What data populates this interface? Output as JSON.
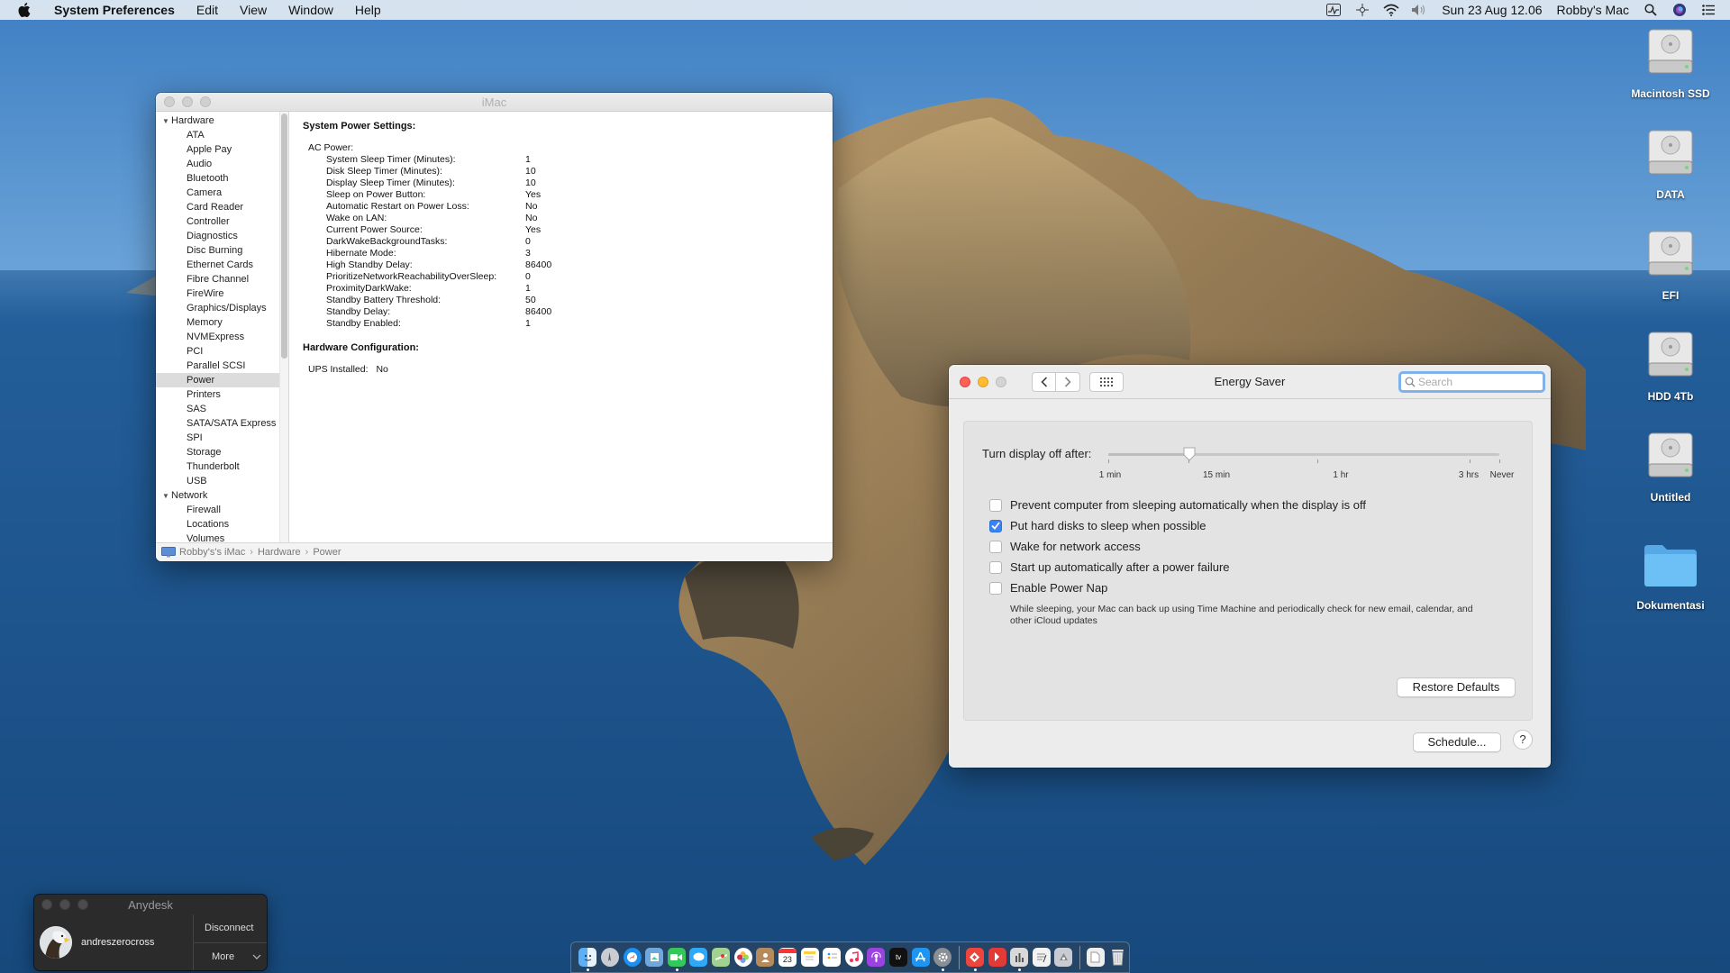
{
  "menubar": {
    "app_name": "System Preferences",
    "menus": [
      "Edit",
      "View",
      "Window",
      "Help"
    ],
    "clock": "Sun 23 Aug  12.06",
    "user": "Robby's Mac"
  },
  "desktop": {
    "icons": [
      {
        "label": "Macintosh SSD",
        "type": "disk"
      },
      {
        "label": "DATA",
        "type": "disk"
      },
      {
        "label": "EFI",
        "type": "disk"
      },
      {
        "label": "HDD 4Tb",
        "type": "disk"
      },
      {
        "label": "Untitled",
        "type": "disk"
      },
      {
        "label": "Dokumentasi",
        "type": "folder"
      }
    ]
  },
  "sysinfo": {
    "title": "iMac",
    "sidebar": {
      "groups": [
        {
          "label": "Hardware",
          "items": [
            "ATA",
            "Apple Pay",
            "Audio",
            "Bluetooth",
            "Camera",
            "Card Reader",
            "Controller",
            "Diagnostics",
            "Disc Burning",
            "Ethernet Cards",
            "Fibre Channel",
            "FireWire",
            "Graphics/Displays",
            "Memory",
            "NVMExpress",
            "PCI",
            "Parallel SCSI",
            "Power",
            "Printers",
            "SAS",
            "SATA/SATA Express",
            "SPI",
            "Storage",
            "Thunderbolt",
            "USB"
          ]
        },
        {
          "label": "Network",
          "items": [
            "Firewall",
            "Locations",
            "Volumes"
          ]
        }
      ],
      "selected": "Power"
    },
    "content": {
      "heading1": "System Power Settings:",
      "ac_power_label": "AC Power:",
      "settings": [
        {
          "k": "System Sleep Timer (Minutes):",
          "v": "1"
        },
        {
          "k": "Disk Sleep Timer (Minutes):",
          "v": "10"
        },
        {
          "k": "Display Sleep Timer (Minutes):",
          "v": "10"
        },
        {
          "k": "Sleep on Power Button:",
          "v": "Yes"
        },
        {
          "k": "Automatic Restart on Power Loss:",
          "v": "No"
        },
        {
          "k": "Wake on LAN:",
          "v": "No"
        },
        {
          "k": "Current Power Source:",
          "v": "Yes"
        },
        {
          "k": "DarkWakeBackgroundTasks:",
          "v": "0"
        },
        {
          "k": "Hibernate Mode:",
          "v": "3"
        },
        {
          "k": "High Standby Delay:",
          "v": "86400"
        },
        {
          "k": "PrioritizeNetworkReachabilityOverSleep:",
          "v": "0"
        },
        {
          "k": "ProximityDarkWake:",
          "v": "1"
        },
        {
          "k": "Standby Battery Threshold:",
          "v": "50"
        },
        {
          "k": "Standby Delay:",
          "v": "86400"
        },
        {
          "k": "Standby Enabled:",
          "v": "1"
        }
      ],
      "heading2": "Hardware Configuration:",
      "ups_label": "UPS Installed:",
      "ups_value": "No"
    },
    "pathbar": [
      "Robby's's iMac",
      "Hardware",
      "Power"
    ]
  },
  "energy": {
    "title": "Energy Saver",
    "search_placeholder": "Search",
    "slider_label": "Turn display off after:",
    "slider_ticks": [
      "1 min",
      "15 min",
      "1 hr",
      "3 hrs",
      "Never"
    ],
    "slider_value": "15 min",
    "options": [
      {
        "label": "Prevent computer from sleeping automatically when the display is off",
        "checked": false
      },
      {
        "label": "Put hard disks to sleep when possible",
        "checked": true
      },
      {
        "label": "Wake for network access",
        "checked": false
      },
      {
        "label": "Start up automatically after a power failure",
        "checked": false
      },
      {
        "label": "Enable Power Nap",
        "checked": false
      }
    ],
    "power_nap_note": "While sleeping, your Mac can back up using Time Machine and periodically check for new email, calendar, and other iCloud updates",
    "restore_defaults": "Restore Defaults",
    "schedule": "Schedule...",
    "help": "?"
  },
  "anydesk": {
    "title": "Anydesk",
    "username": "andreszerocross",
    "disconnect": "Disconnect",
    "more": "More"
  },
  "dock": {
    "calendar_day": "23"
  }
}
